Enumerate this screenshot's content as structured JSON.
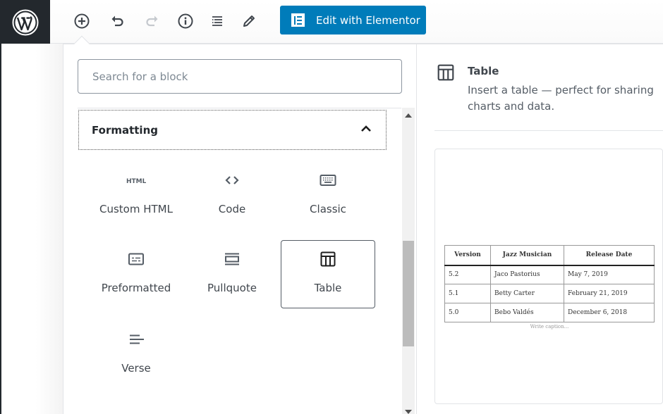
{
  "toolbar": {
    "logo": "wordpress-logo",
    "tools": [
      {
        "name": "add-block",
        "icon": "plus-circle-icon",
        "enabled": true
      },
      {
        "name": "undo",
        "icon": "undo-icon",
        "enabled": true
      },
      {
        "name": "redo",
        "icon": "redo-icon",
        "enabled": false
      },
      {
        "name": "content-info",
        "icon": "info-icon",
        "enabled": true
      },
      {
        "name": "block-navigation",
        "icon": "list-icon",
        "enabled": true
      },
      {
        "name": "tools",
        "icon": "pencil-icon",
        "enabled": true
      }
    ],
    "elementor_button": "Edit with Elementor",
    "accent_color": "#007cba"
  },
  "inserter": {
    "search_placeholder": "Search for a block",
    "search_value": "",
    "panel": {
      "title": "Formatting",
      "expanded": true,
      "blocks": [
        {
          "label": "Custom HTML",
          "icon": "html-icon"
        },
        {
          "label": "Code",
          "icon": "code-icon"
        },
        {
          "label": "Classic",
          "icon": "keyboard-icon"
        },
        {
          "label": "Preformatted",
          "icon": "preformatted-icon"
        },
        {
          "label": "Pullquote",
          "icon": "pullquote-icon"
        },
        {
          "label": "Table",
          "icon": "table-icon",
          "active": true
        },
        {
          "label": "Verse",
          "icon": "verse-icon"
        }
      ]
    }
  },
  "preview": {
    "title": "Table",
    "description": "Insert a table — perfect for sharing charts and data.",
    "table": {
      "headers": [
        "Version",
        "Jazz Musician",
        "Release Date"
      ],
      "rows": [
        [
          "5.2",
          "Jaco Pastorius",
          "May 7, 2019"
        ],
        [
          "5.1",
          "Betty Carter",
          "February 21, 2019"
        ],
        [
          "5.0",
          "Bebo Valdés",
          "December 6, 2018"
        ]
      ],
      "caption_placeholder": "Write caption..."
    }
  }
}
